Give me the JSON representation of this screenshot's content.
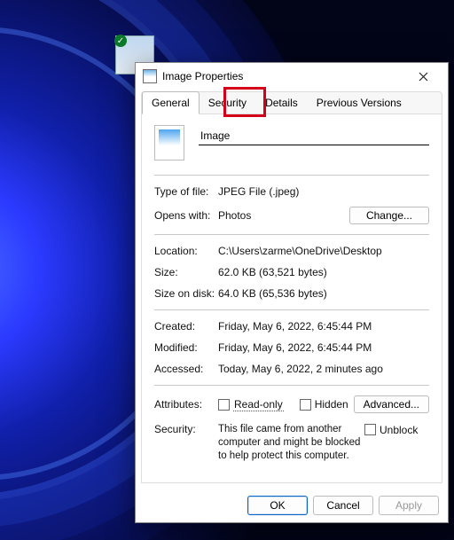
{
  "window": {
    "title": "Image Properties"
  },
  "tabs": {
    "general": "General",
    "security": "Security",
    "details": "Details",
    "previous": "Previous Versions"
  },
  "file": {
    "name": "Image"
  },
  "labels": {
    "type": "Type of file:",
    "opens": "Opens with:",
    "location": "Location:",
    "size": "Size:",
    "sizeondisk": "Size on disk:",
    "created": "Created:",
    "modified": "Modified:",
    "accessed": "Accessed:",
    "attributes": "Attributes:",
    "security": "Security:",
    "readonly": "Read-only",
    "hidden": "Hidden",
    "change": "Change...",
    "advanced": "Advanced...",
    "unblock": "Unblock",
    "ok": "OK",
    "cancel": "Cancel",
    "apply": "Apply"
  },
  "values": {
    "type": "JPEG File (.jpeg)",
    "opens": "Photos",
    "location": "C:\\Users\\zarme\\OneDrive\\Desktop",
    "size": "62.0 KB (63,521 bytes)",
    "sizeondisk": "64.0 KB (65,536 bytes)",
    "created": "Friday, May 6, 2022, 6:45:44 PM",
    "modified": "Friday, May 6, 2022, 6:45:44 PM",
    "accessed": "Today, May 6, 2022, 2 minutes ago",
    "securitynote": "This file came from another computer and might be blocked to help protect this computer."
  }
}
